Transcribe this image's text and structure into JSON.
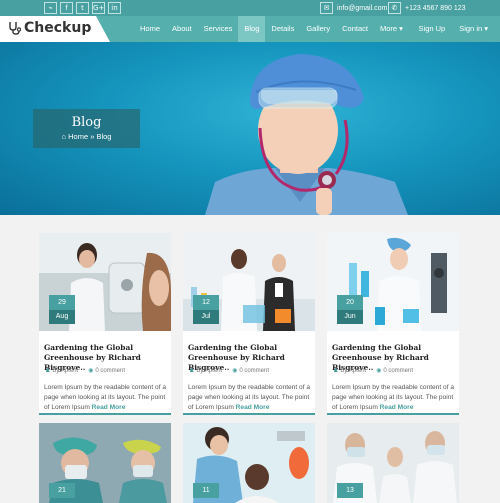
{
  "topbar": {
    "social": [
      {
        "icon": "rss-icon",
        "glyph": "⌁"
      },
      {
        "icon": "facebook-icon",
        "glyph": "f"
      },
      {
        "icon": "twitter-icon",
        "glyph": "t"
      },
      {
        "icon": "google-plus-icon",
        "glyph": "G+"
      },
      {
        "icon": "linkedin-icon",
        "glyph": "in"
      }
    ],
    "email": "info@gmail.com",
    "phone": "+123 4567 890 123"
  },
  "brand": {
    "name": "Checkup",
    "logo_icon": "stethoscope-icon"
  },
  "nav": {
    "items": [
      {
        "label": "Home"
      },
      {
        "label": "About"
      },
      {
        "label": "Services"
      },
      {
        "label": "Blog",
        "active": true
      },
      {
        "label": "Details"
      },
      {
        "label": "Gallery"
      },
      {
        "label": "Contact"
      },
      {
        "label": "More ▾"
      }
    ],
    "signup": "Sign Up",
    "signin": "Sign in ▾"
  },
  "hero": {
    "title": "Blog",
    "breadcrumb": "Home » Blog",
    "home_icon": "home-icon"
  },
  "posts": [
    {
      "day": "29",
      "month": "Aug",
      "title": "Gardening the Global Greenhouse by Richard Bisgrove..",
      "author": "By Aptent",
      "comments": "0 comment",
      "excerpt": "Lorem Ipsum by the readable content of a page when looking at its layout. The point of Lorem Ipsum",
      "more": "Read More"
    },
    {
      "day": "12",
      "month": "Jul",
      "title": "Gardening the Global Greenhouse by Richard Bisgrove..",
      "author": "By Aptent",
      "comments": "0 comment",
      "excerpt": "Lorem Ipsum by the readable content of a page when looking at its layout. The point of Lorem Ipsum",
      "more": "Read More"
    },
    {
      "day": "20",
      "month": "Jun",
      "title": "Gardening the Global Greenhouse by Richard Bisgrove..",
      "author": "By Aptent",
      "comments": "0 comment",
      "excerpt": "Lorem Ipsum by the readable content of a page when looking at its layout. The point of Lorem Ipsum",
      "more": "Read More"
    }
  ],
  "posts_row2": [
    {
      "day": "21"
    },
    {
      "day": "11"
    },
    {
      "day": "13"
    }
  ],
  "colors": {
    "accent": "#49a0a0",
    "nav": "#55b0ad",
    "hero": "#1595bd"
  }
}
